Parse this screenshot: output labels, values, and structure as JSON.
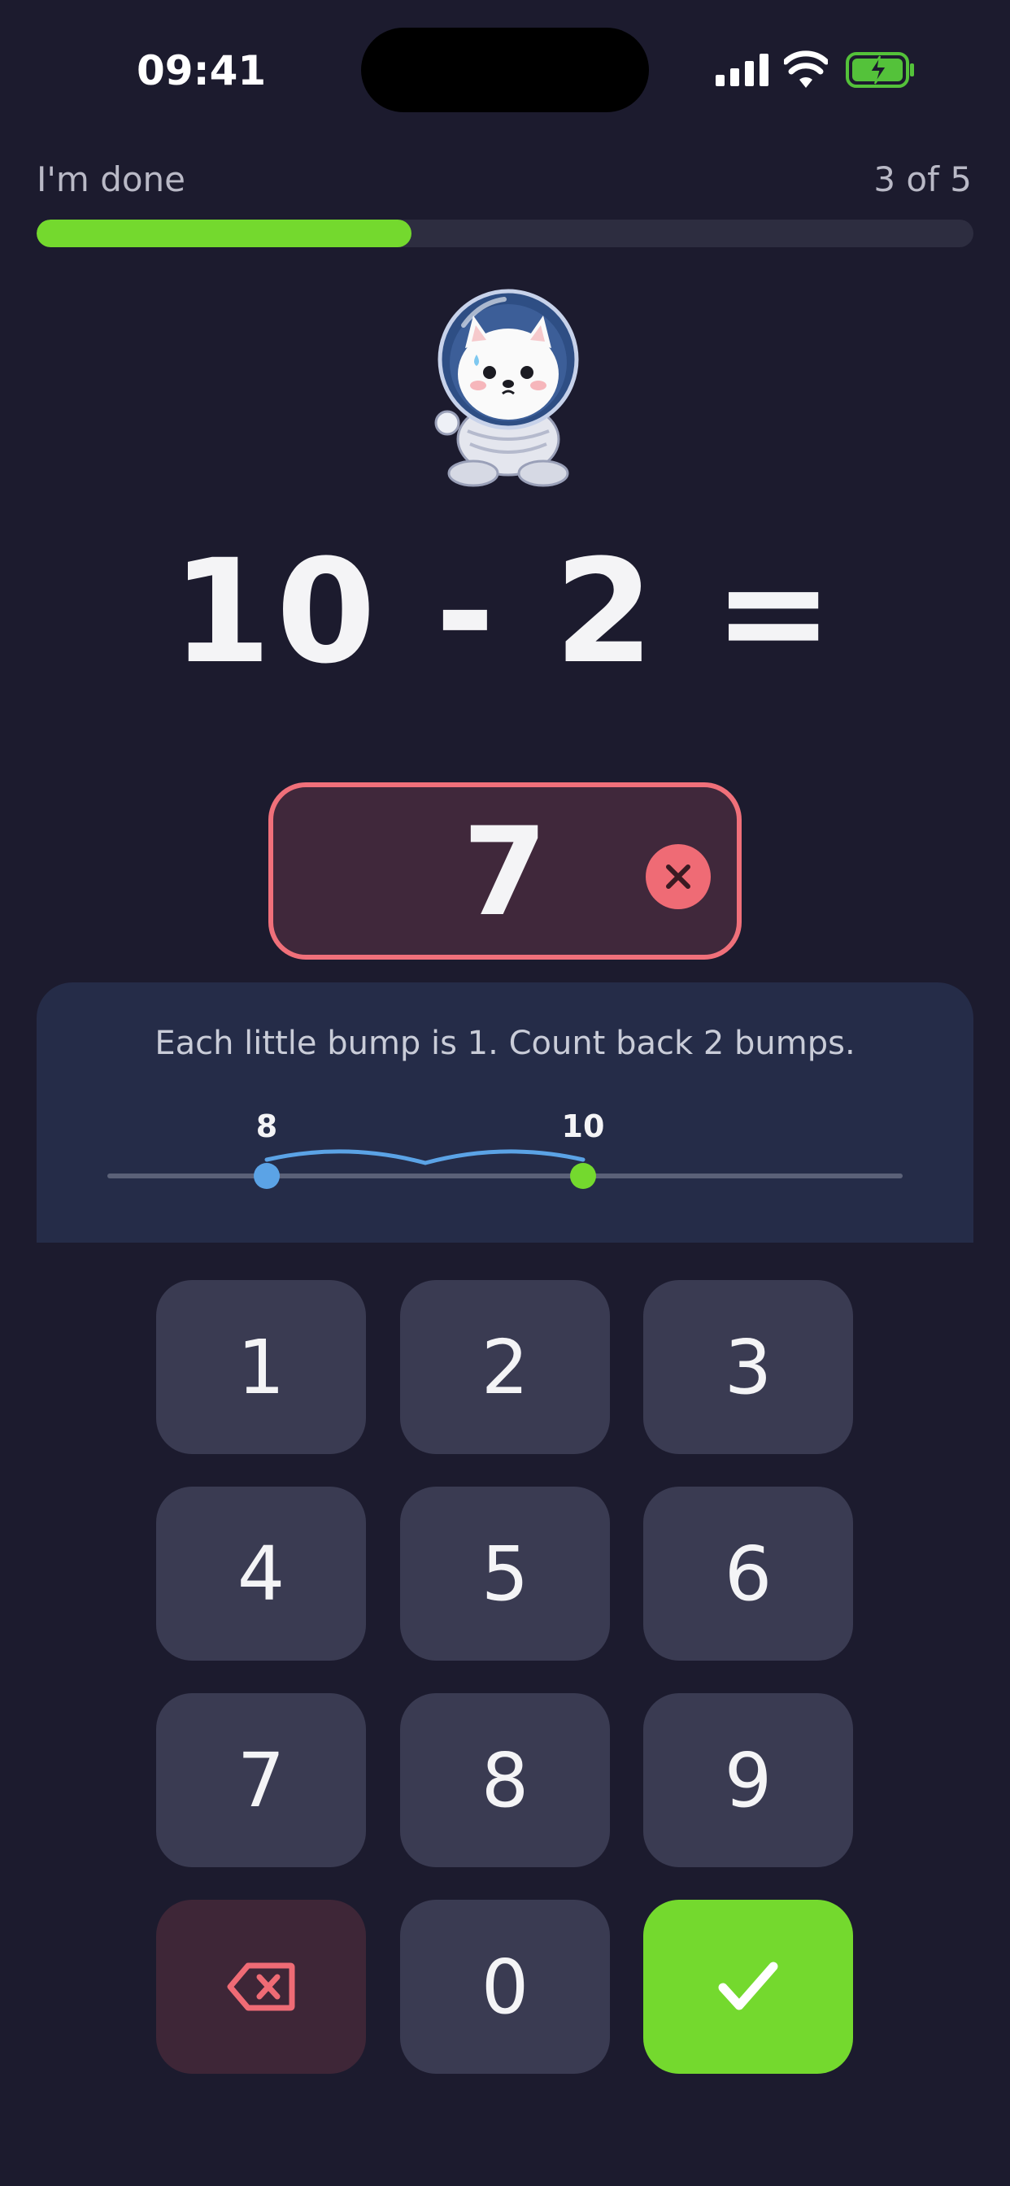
{
  "status_bar": {
    "time": "09:41"
  },
  "header": {
    "done_label": "I'm done",
    "progress_label": "3 of 5",
    "progress_fraction": 0.4
  },
  "mascot": {
    "icon": "astronaut-dog-mascot"
  },
  "question": {
    "equation": "10 - 2 ="
  },
  "answer": {
    "value": "7",
    "state": "incorrect"
  },
  "hint": {
    "text": "Each little bump is 1. Count back 2 bumps.",
    "number_line": {
      "start_label": "10",
      "end_label": "8",
      "start_color": "#74d92e",
      "end_color": "#5ba3e6"
    }
  },
  "keypad": {
    "keys": [
      "1",
      "2",
      "3",
      "4",
      "5",
      "6",
      "7",
      "8",
      "9"
    ],
    "zero": "0",
    "backspace_icon": "backspace-icon",
    "submit_icon": "checkmark-icon"
  },
  "colors": {
    "background": "#1c1b2e",
    "accent_green": "#74d92e",
    "error_red": "#f0707a",
    "key": "#3a3b52",
    "hint_panel": "#252c48"
  }
}
